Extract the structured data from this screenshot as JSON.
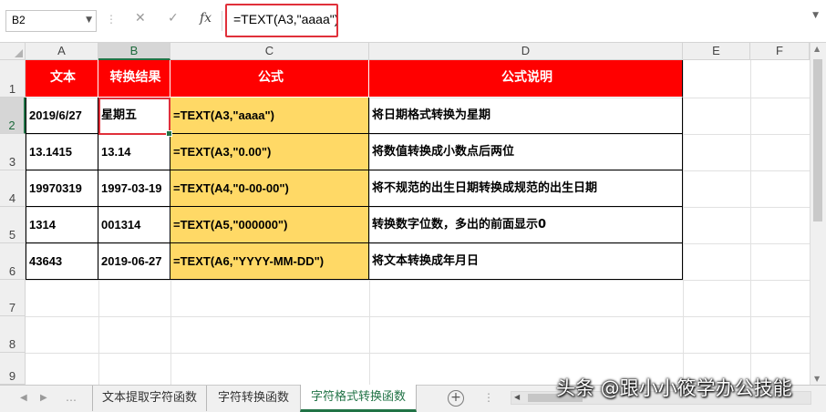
{
  "formula_bar": {
    "name_box": "B2",
    "cancel_icon": "✕",
    "enter_icon": "✓",
    "fx_label": "fx",
    "formula": "=TEXT(A3,\"aaaa\")"
  },
  "columns": [
    "A",
    "B",
    "C",
    "D",
    "E",
    "F"
  ],
  "rows": [
    "1",
    "2",
    "3",
    "4",
    "5",
    "6",
    "7",
    "8",
    "9"
  ],
  "table": {
    "headers": [
      "文本",
      "转换结果",
      "公式",
      "公式说明"
    ],
    "rows": [
      [
        "2019/6/27",
        "星期五",
        "=TEXT(A3,\"aaaa\")",
        "将日期格式转换为星期"
      ],
      [
        "13.1415",
        "13.14",
        "=TEXT(A3,\"0.00\")",
        "将数值转换成小数点后两位"
      ],
      [
        "19970319",
        "1997-03-19",
        "=TEXT(A4,\"0-00-00\")",
        "将不规范的出生日期转换成规范的出生日期"
      ],
      [
        "1314",
        "001314",
        "=TEXT(A5,\"000000\")",
        "转换数字位数，多出的前面显示0"
      ],
      [
        "43643",
        "2019-06-27",
        "=TEXT(A6,\"YYYY-MM-DD\")",
        "将文本转换成年月日"
      ]
    ]
  },
  "sheet_tabs": [
    "文本提取字符函数",
    "字符转换函数",
    "字符格式转换函数"
  ],
  "active_tab": "字符格式转换函数",
  "watermark": "头条 @跟小小筱学办公技能",
  "colors": {
    "header_fill": "#ff0000",
    "formula_fill": "#ffd966",
    "highlight_border": "#e0303a",
    "excel_green": "#217346"
  }
}
